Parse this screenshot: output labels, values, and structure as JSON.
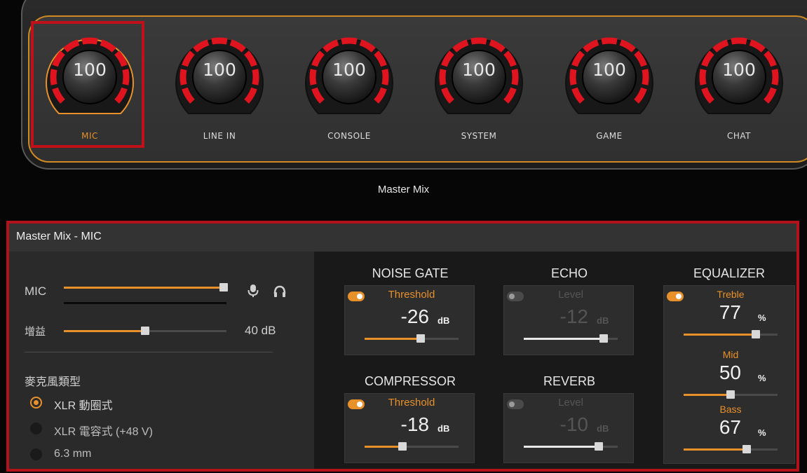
{
  "mixer": {
    "title": "Master Mix",
    "channels": [
      {
        "label": "MIC",
        "value": "100",
        "active": true
      },
      {
        "label": "LINE IN",
        "value": "100",
        "active": false
      },
      {
        "label": "CONSOLE",
        "value": "100",
        "active": false
      },
      {
        "label": "SYSTEM",
        "value": "100",
        "active": false
      },
      {
        "label": "GAME",
        "value": "100",
        "active": false
      },
      {
        "label": "CHAT",
        "value": "100",
        "active": false
      }
    ]
  },
  "detail": {
    "title": "Master Mix - MIC",
    "mic_label": "MIC",
    "mic_level": 1.0,
    "gain_label": "增益",
    "gain_value": "40 dB",
    "gain_level": 0.5,
    "mic_type_title": "麥克風類型",
    "mic_types": [
      {
        "label": "XLR 動圈式",
        "selected": true
      },
      {
        "label": "XLR 電容式 (+48 V)",
        "selected": false
      },
      {
        "label": "6.3 mm",
        "selected": false
      }
    ]
  },
  "effects": {
    "noise_gate": {
      "title": "NOISE GATE",
      "enabled": true,
      "param": "Threshold",
      "value": "-26",
      "unit": "dB",
      "level": 0.6
    },
    "echo": {
      "title": "ECHO",
      "enabled": false,
      "param": "Level",
      "value": "-12",
      "unit": "dB",
      "level": 0.85
    },
    "compressor": {
      "title": "COMPRESSOR",
      "enabled": true,
      "param": "Threshold",
      "value": "-18",
      "unit": "dB",
      "level": 0.4
    },
    "reverb": {
      "title": "REVERB",
      "enabled": false,
      "param": "Level",
      "value": "-10",
      "unit": "dB",
      "level": 0.8
    },
    "equalizer": {
      "title": "EQUALIZER",
      "enabled": true,
      "bands": [
        {
          "label": "Treble",
          "value": "77",
          "unit": "%",
          "level": 0.77
        },
        {
          "label": "Mid",
          "value": "50",
          "unit": "%",
          "level": 0.5
        },
        {
          "label": "Bass",
          "value": "67",
          "unit": "%",
          "level": 0.67
        }
      ]
    }
  },
  "colors": {
    "accent": "#e8902a",
    "ring": "#e0141e",
    "highlight": "#c0101a"
  }
}
